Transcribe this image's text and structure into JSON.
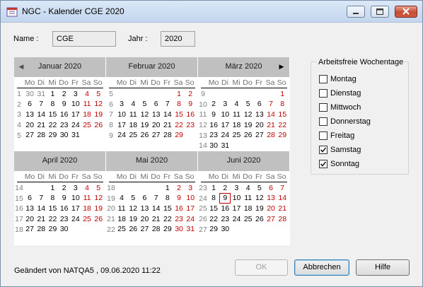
{
  "window": {
    "title": "NGC - Kalender CGE 2020"
  },
  "form": {
    "name_label": "Name :",
    "name_value": "CGE",
    "year_label": "Jahr :",
    "year_value": "2020"
  },
  "calendar": {
    "weekdays": [
      "Mo",
      "Di",
      "Mi",
      "Do",
      "Fr",
      "Sa",
      "So"
    ],
    "months": [
      {
        "title": "Januar 2020",
        "weeks": [
          {
            "wk": "1",
            "days": [
              {
                "d": "30",
                "o": true
              },
              {
                "d": "31",
                "o": true
              },
              {
                "d": "1"
              },
              {
                "d": "2"
              },
              {
                "d": "3"
              },
              {
                "d": "4"
              },
              {
                "d": "5"
              }
            ]
          },
          {
            "wk": "2",
            "days": [
              {
                "d": "6"
              },
              {
                "d": "7"
              },
              {
                "d": "8"
              },
              {
                "d": "9"
              },
              {
                "d": "10"
              },
              {
                "d": "11"
              },
              {
                "d": "12"
              }
            ]
          },
          {
            "wk": "3",
            "days": [
              {
                "d": "13"
              },
              {
                "d": "14"
              },
              {
                "d": "15"
              },
              {
                "d": "16"
              },
              {
                "d": "17"
              },
              {
                "d": "18"
              },
              {
                "d": "19"
              }
            ]
          },
          {
            "wk": "4",
            "days": [
              {
                "d": "20"
              },
              {
                "d": "21"
              },
              {
                "d": "22"
              },
              {
                "d": "23"
              },
              {
                "d": "24"
              },
              {
                "d": "25"
              },
              {
                "d": "26"
              }
            ]
          },
          {
            "wk": "5",
            "days": [
              {
                "d": "27"
              },
              {
                "d": "28"
              },
              {
                "d": "29"
              },
              {
                "d": "30"
              },
              {
                "d": "31"
              },
              {
                "d": ""
              },
              {
                "d": ""
              }
            ]
          }
        ]
      },
      {
        "title": "Februar 2020",
        "weeks": [
          {
            "wk": "5",
            "days": [
              {
                "d": ""
              },
              {
                "d": ""
              },
              {
                "d": ""
              },
              {
                "d": ""
              },
              {
                "d": ""
              },
              {
                "d": "1"
              },
              {
                "d": "2"
              }
            ]
          },
          {
            "wk": "6",
            "days": [
              {
                "d": "3"
              },
              {
                "d": "4"
              },
              {
                "d": "5"
              },
              {
                "d": "6"
              },
              {
                "d": "7"
              },
              {
                "d": "8"
              },
              {
                "d": "9"
              }
            ]
          },
          {
            "wk": "7",
            "days": [
              {
                "d": "10"
              },
              {
                "d": "11"
              },
              {
                "d": "12"
              },
              {
                "d": "13"
              },
              {
                "d": "14"
              },
              {
                "d": "15"
              },
              {
                "d": "16"
              }
            ]
          },
          {
            "wk": "8",
            "days": [
              {
                "d": "17"
              },
              {
                "d": "18"
              },
              {
                "d": "19"
              },
              {
                "d": "20"
              },
              {
                "d": "21"
              },
              {
                "d": "22"
              },
              {
                "d": "23"
              }
            ]
          },
          {
            "wk": "9",
            "days": [
              {
                "d": "24"
              },
              {
                "d": "25"
              },
              {
                "d": "26"
              },
              {
                "d": "27"
              },
              {
                "d": "28"
              },
              {
                "d": "29"
              },
              {
                "d": ""
              }
            ]
          }
        ]
      },
      {
        "title": "März 2020",
        "weeks": [
          {
            "wk": "9",
            "days": [
              {
                "d": ""
              },
              {
                "d": ""
              },
              {
                "d": ""
              },
              {
                "d": ""
              },
              {
                "d": ""
              },
              {
                "d": ""
              },
              {
                "d": "1"
              }
            ]
          },
          {
            "wk": "10",
            "days": [
              {
                "d": "2"
              },
              {
                "d": "3"
              },
              {
                "d": "4"
              },
              {
                "d": "5"
              },
              {
                "d": "6"
              },
              {
                "d": "7"
              },
              {
                "d": "8"
              }
            ]
          },
          {
            "wk": "11",
            "days": [
              {
                "d": "9"
              },
              {
                "d": "10"
              },
              {
                "d": "11"
              },
              {
                "d": "12"
              },
              {
                "d": "13"
              },
              {
                "d": "14"
              },
              {
                "d": "15"
              }
            ]
          },
          {
            "wk": "12",
            "days": [
              {
                "d": "16"
              },
              {
                "d": "17"
              },
              {
                "d": "18"
              },
              {
                "d": "19"
              },
              {
                "d": "20"
              },
              {
                "d": "21"
              },
              {
                "d": "22"
              }
            ]
          },
          {
            "wk": "13",
            "days": [
              {
                "d": "23"
              },
              {
                "d": "24"
              },
              {
                "d": "25"
              },
              {
                "d": "26"
              },
              {
                "d": "27"
              },
              {
                "d": "28"
              },
              {
                "d": "29"
              }
            ]
          },
          {
            "wk": "14",
            "days": [
              {
                "d": "30"
              },
              {
                "d": "31"
              },
              {
                "d": ""
              },
              {
                "d": ""
              },
              {
                "d": ""
              },
              {
                "d": ""
              },
              {
                "d": ""
              }
            ]
          }
        ]
      },
      {
        "title": "April 2020",
        "weeks": [
          {
            "wk": "14",
            "days": [
              {
                "d": ""
              },
              {
                "d": ""
              },
              {
                "d": "1"
              },
              {
                "d": "2"
              },
              {
                "d": "3"
              },
              {
                "d": "4"
              },
              {
                "d": "5"
              }
            ]
          },
          {
            "wk": "15",
            "days": [
              {
                "d": "6"
              },
              {
                "d": "7"
              },
              {
                "d": "8"
              },
              {
                "d": "9"
              },
              {
                "d": "10"
              },
              {
                "d": "11"
              },
              {
                "d": "12"
              }
            ]
          },
          {
            "wk": "16",
            "days": [
              {
                "d": "13"
              },
              {
                "d": "14"
              },
              {
                "d": "15"
              },
              {
                "d": "16"
              },
              {
                "d": "17"
              },
              {
                "d": "18"
              },
              {
                "d": "19"
              }
            ]
          },
          {
            "wk": "17",
            "days": [
              {
                "d": "20"
              },
              {
                "d": "21"
              },
              {
                "d": "22"
              },
              {
                "d": "23"
              },
              {
                "d": "24"
              },
              {
                "d": "25"
              },
              {
                "d": "26"
              }
            ]
          },
          {
            "wk": "18",
            "days": [
              {
                "d": "27"
              },
              {
                "d": "28"
              },
              {
                "d": "29"
              },
              {
                "d": "30"
              },
              {
                "d": ""
              },
              {
                "d": ""
              },
              {
                "d": ""
              }
            ]
          }
        ]
      },
      {
        "title": "Mai 2020",
        "weeks": [
          {
            "wk": "18",
            "days": [
              {
                "d": ""
              },
              {
                "d": ""
              },
              {
                "d": ""
              },
              {
                "d": ""
              },
              {
                "d": "1"
              },
              {
                "d": "2"
              },
              {
                "d": "3"
              }
            ]
          },
          {
            "wk": "19",
            "days": [
              {
                "d": "4"
              },
              {
                "d": "5"
              },
              {
                "d": "6"
              },
              {
                "d": "7"
              },
              {
                "d": "8"
              },
              {
                "d": "9"
              },
              {
                "d": "10"
              }
            ]
          },
          {
            "wk": "20",
            "days": [
              {
                "d": "11"
              },
              {
                "d": "12"
              },
              {
                "d": "13"
              },
              {
                "d": "14"
              },
              {
                "d": "15"
              },
              {
                "d": "16"
              },
              {
                "d": "17"
              }
            ]
          },
          {
            "wk": "21",
            "days": [
              {
                "d": "18"
              },
              {
                "d": "19"
              },
              {
                "d": "20"
              },
              {
                "d": "21"
              },
              {
                "d": "22"
              },
              {
                "d": "23"
              },
              {
                "d": "24"
              }
            ]
          },
          {
            "wk": "22",
            "days": [
              {
                "d": "25"
              },
              {
                "d": "26"
              },
              {
                "d": "27"
              },
              {
                "d": "28"
              },
              {
                "d": "29"
              },
              {
                "d": "30"
              },
              {
                "d": "31"
              }
            ]
          }
        ]
      },
      {
        "title": "Juni 2020",
        "weeks": [
          {
            "wk": "23",
            "days": [
              {
                "d": "1"
              },
              {
                "d": "2"
              },
              {
                "d": "3"
              },
              {
                "d": "4"
              },
              {
                "d": "5"
              },
              {
                "d": "6"
              },
              {
                "d": "7"
              }
            ]
          },
          {
            "wk": "24",
            "days": [
              {
                "d": "8"
              },
              {
                "d": "9",
                "today": true
              },
              {
                "d": "10"
              },
              {
                "d": "11"
              },
              {
                "d": "12"
              },
              {
                "d": "13"
              },
              {
                "d": "14"
              }
            ]
          },
          {
            "wk": "25",
            "days": [
              {
                "d": "15"
              },
              {
                "d": "16"
              },
              {
                "d": "17"
              },
              {
                "d": "18"
              },
              {
                "d": "19"
              },
              {
                "d": "20"
              },
              {
                "d": "21"
              }
            ]
          },
          {
            "wk": "26",
            "days": [
              {
                "d": "22"
              },
              {
                "d": "23"
              },
              {
                "d": "24"
              },
              {
                "d": "25"
              },
              {
                "d": "26"
              },
              {
                "d": "27"
              },
              {
                "d": "28"
              }
            ]
          },
          {
            "wk": "27",
            "days": [
              {
                "d": "29"
              },
              {
                "d": "30"
              },
              {
                "d": ""
              },
              {
                "d": ""
              },
              {
                "d": ""
              },
              {
                "d": ""
              },
              {
                "d": ""
              }
            ]
          }
        ]
      }
    ]
  },
  "non_working_days": {
    "title": "Arbeitsfreie Wochentage",
    "items": [
      {
        "label": "Montag",
        "checked": false
      },
      {
        "label": "Dienstag",
        "checked": false
      },
      {
        "label": "Mittwoch",
        "checked": false
      },
      {
        "label": "Donnerstag",
        "checked": false
      },
      {
        "label": "Freitag",
        "checked": false
      },
      {
        "label": "Samstag",
        "checked": true
      },
      {
        "label": "Sonntag",
        "checked": true
      }
    ]
  },
  "footer": {
    "status": "Geändert von NATQA5 , 09.06.2020 11:22",
    "ok_label": "OK",
    "cancel_label": "Abbrechen",
    "help_label": "Hilfe"
  },
  "colors": {
    "weekend": "#c00000",
    "header_bg": "#c0c0c0",
    "muted": "#808080"
  }
}
